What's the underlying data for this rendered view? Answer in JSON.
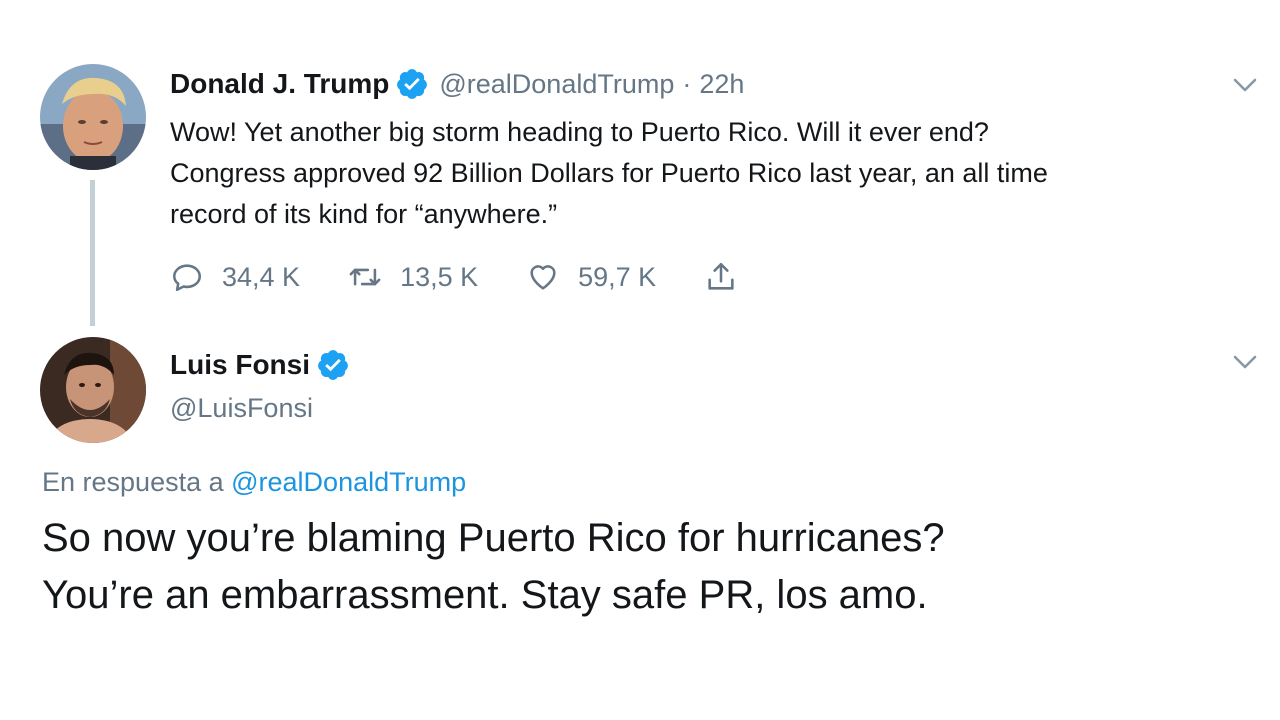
{
  "tweet1": {
    "display_name": "Donald J. Trump",
    "handle": "@realDonaldTrump",
    "separator": "·",
    "time": "22h",
    "text_lines": [
      "Wow! Yet another big storm heading to Puerto Rico. Will it ever end?",
      "Congress approved 92 Billion Dollars for Puerto Rico last year, an all time",
      "record of its kind for “anywhere.”"
    ],
    "actions": {
      "replies": "34,4 K",
      "retweets": "13,5 K",
      "likes": "59,7 K"
    }
  },
  "tweet2": {
    "display_name": "Luis Fonsi",
    "handle": "@LuisFonsi",
    "reply_prefix": "En respuesta a ",
    "reply_mention": "@realDonaldTrump",
    "text_lines": [
      "So now you’re blaming Puerto Rico for hurricanes?",
      "You’re an embarrassment. Stay safe PR, los amo."
    ]
  },
  "icons": {
    "verified": "verified-badge-icon",
    "caret": "chevron-down-icon",
    "reply": "reply-icon",
    "retweet": "retweet-icon",
    "like": "heart-icon",
    "share": "share-icon"
  },
  "colors": {
    "verified": "#1da1f2",
    "secondary_text": "#657786",
    "link": "#1b95e0",
    "thread_line": "#c4cfd6"
  }
}
